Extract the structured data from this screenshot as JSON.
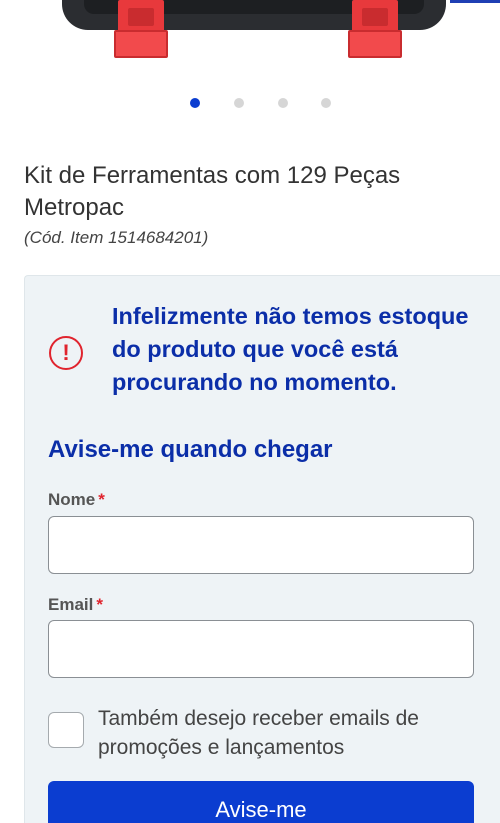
{
  "product": {
    "title": "Kit de Ferramentas com 129 Peças Metropac",
    "sku": "(Cód. Item 1514684201)"
  },
  "carousel": {
    "total": 4,
    "active_index": 0
  },
  "stock_alert": {
    "message": "Infelizmente não temos estoque do produto que você está procurando no momento.",
    "icon": "exclamation-circle-icon",
    "icon_glyph": "!"
  },
  "notify_form": {
    "heading": "Avise-me quando chegar",
    "name_label": "Nome",
    "email_label": "Email",
    "required_mark": "*",
    "name_value": "",
    "email_value": "",
    "newsletter_label": "Também desejo receber emails de promoções e lançamentos",
    "newsletter_checked": false,
    "submit_label": "Avise-me"
  },
  "colors": {
    "brand_blue": "#0b3dd0",
    "heading_blue": "#0b2ea8",
    "alert_red": "#e0242e",
    "panel_bg": "#eef3f6"
  }
}
